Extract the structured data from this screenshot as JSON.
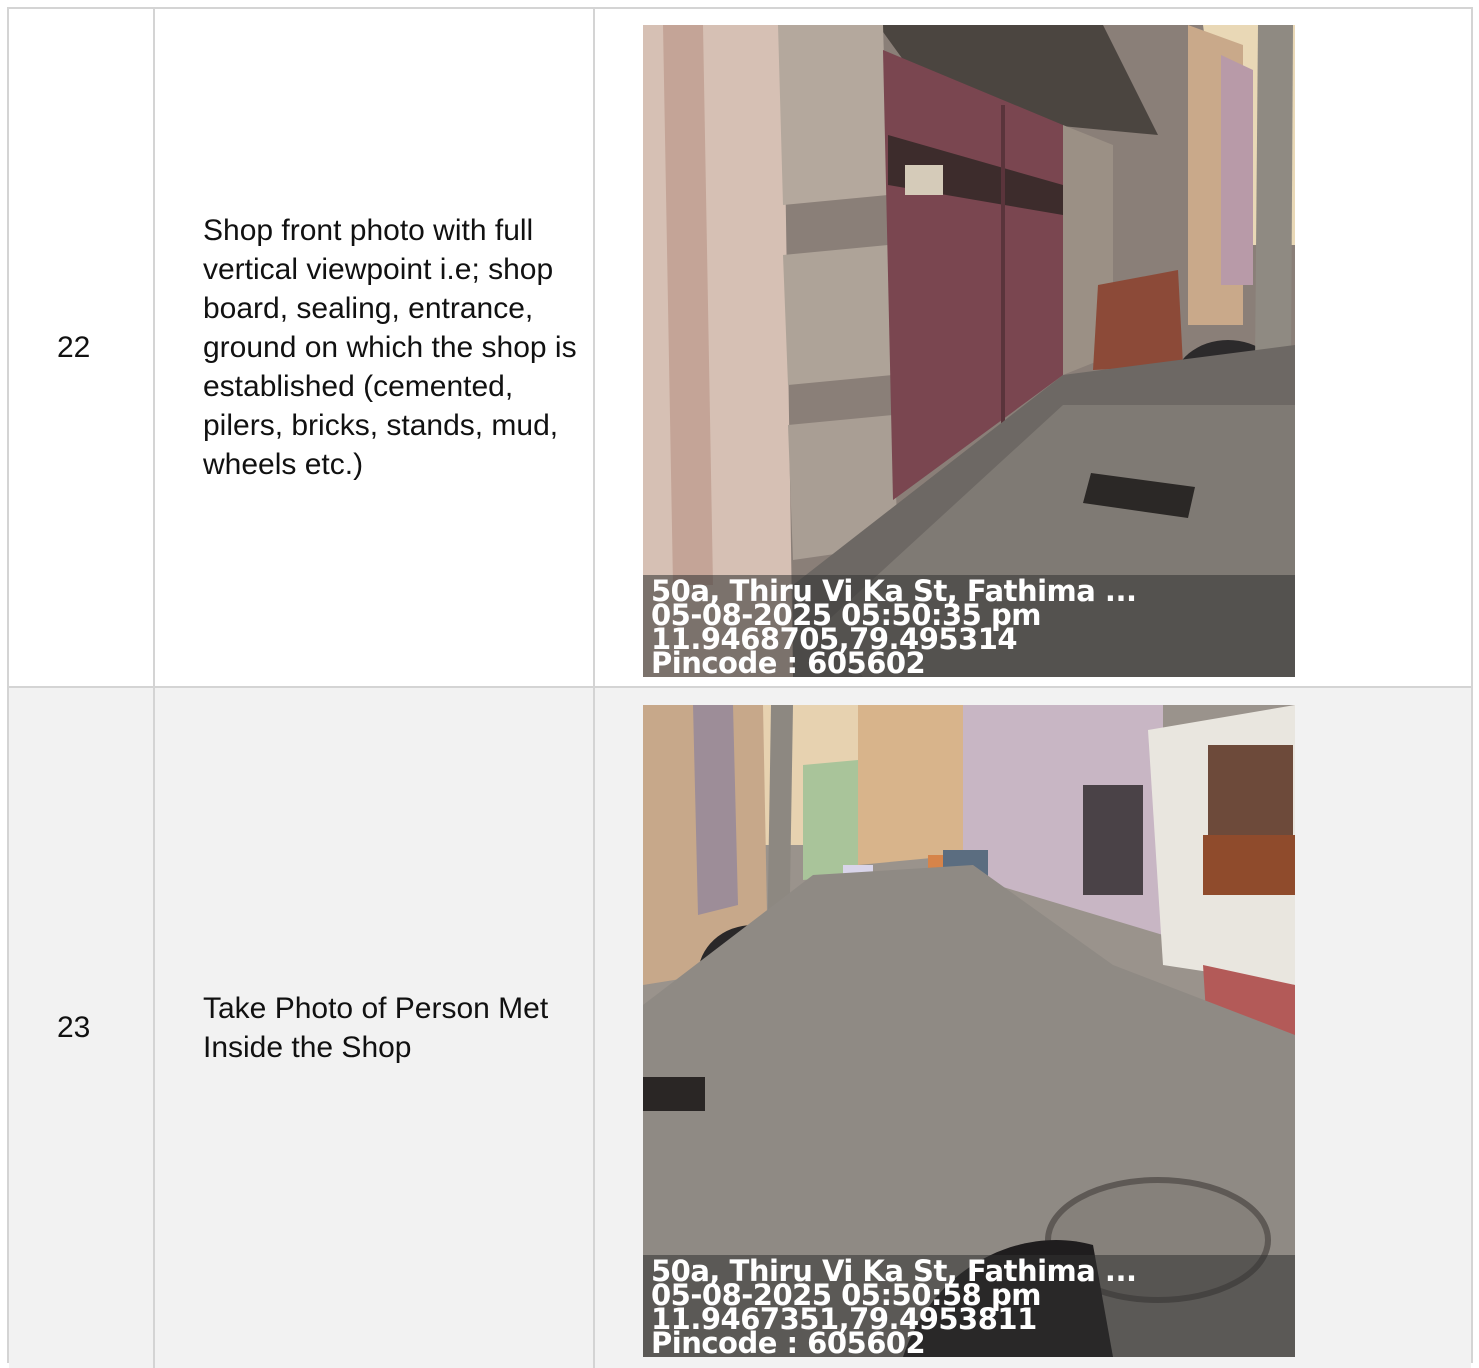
{
  "rows": [
    {
      "number": "22",
      "description": "Shop front photo with full vertical viewpoint i.e; shop board, sealing, entrance, ground on which the shop is established (cemented, pilers, bricks, stands, mud, wheels etc.)",
      "photo": {
        "address": "50a, Thiru Vi Ka St, Fathima ...",
        "datetime": "05-08-2025 05:50:35 pm",
        "coordinates": "11.9468705,79.495314",
        "pincode": "Pincode : 605602"
      }
    },
    {
      "number": "23",
      "description": "Take Photo of Person Met Inside the Shop",
      "photo": {
        "address": "50a, Thiru Vi Ka St, Fathima ...",
        "datetime": "05-08-2025 05:50:58 pm",
        "coordinates": "11.9467351,79.4953811",
        "pincode": "Pincode : 605602"
      }
    }
  ]
}
